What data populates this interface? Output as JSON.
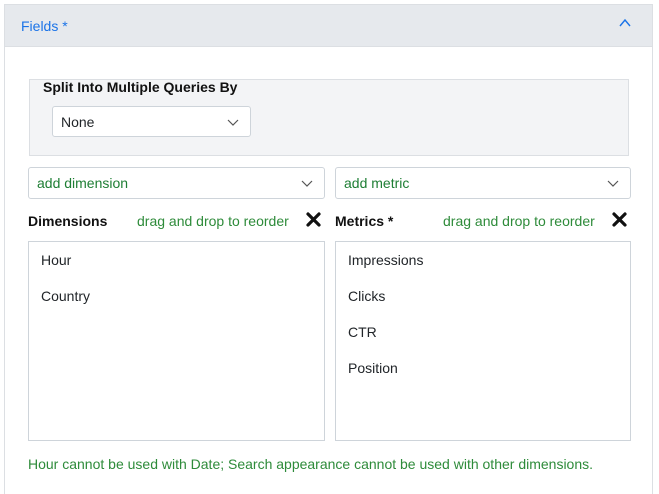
{
  "fields_panel": {
    "title": "Fields *",
    "split": {
      "label": "Split Into Multiple Queries By",
      "selected": "None"
    },
    "add_dimension": "add dimension",
    "add_metric": "add metric",
    "dimensions": {
      "label": "Dimensions",
      "hint": "drag and drop to reorder",
      "items": [
        "Hour",
        "Country"
      ]
    },
    "metrics": {
      "label": "Metrics *",
      "hint": "drag and drop to reorder",
      "items": [
        "Impressions",
        "Clicks",
        "CTR",
        "Position"
      ]
    },
    "note": "Hour cannot be used with Date; Search appearance cannot be used with other dimensions."
  },
  "colors": {
    "link_blue": "#1a73e8",
    "hint_green": "#2e8b3a",
    "header_bg": "#e6e9ed"
  },
  "icons": {
    "collapse": "chevron-up-icon",
    "dropdown": "chevron-down-icon",
    "clear": "close-x-icon"
  }
}
